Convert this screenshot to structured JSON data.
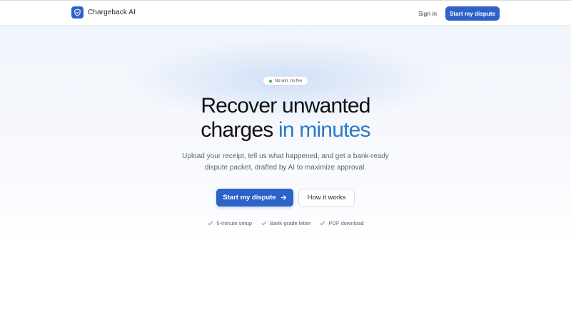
{
  "nav": {
    "brand": "Chargeback AI",
    "logo_icon": "shield-check-icon",
    "signin_label": "Sign in",
    "cta_label": "Start my dispute"
  },
  "hero": {
    "pill_text": "No win, no fee",
    "headline_line1": "Recover unwanted",
    "headline_line2_plain": "charges",
    "headline_line2_accent": "in minutes",
    "subtitle": "Upload your receipt, tell us what happened, and get a bank-ready dispute packet, drafted by AI to maximize approval.",
    "primary_label": "Start my dispute",
    "primary_icon": "arrow-right-icon",
    "secondary_label": "How it works"
  },
  "features": [
    {
      "icon": "check-icon",
      "label": "5-minute setup"
    },
    {
      "icon": "check-icon",
      "label": "Bank-grade letter"
    },
    {
      "icon": "check-icon",
      "label": "PDF download"
    }
  ],
  "colors": {
    "primary": "#2d62c9",
    "accent_text": "#2a7bc9",
    "status_dot": "#46b26b"
  }
}
